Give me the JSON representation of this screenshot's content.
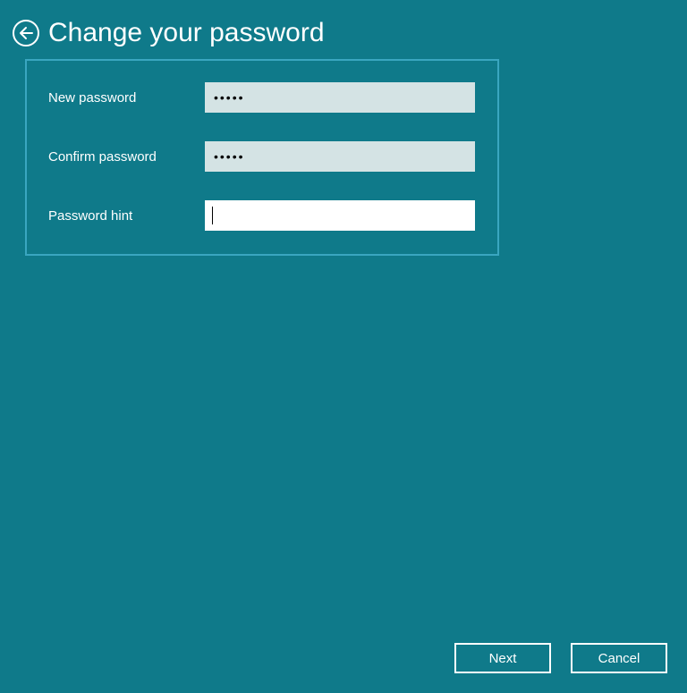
{
  "header": {
    "title": "Change your password"
  },
  "form": {
    "new_password": {
      "label": "New password",
      "masked_value": "•••••"
    },
    "confirm_password": {
      "label": "Confirm password",
      "masked_value": "•••••"
    },
    "password_hint": {
      "label": "Password hint",
      "value": ""
    }
  },
  "buttons": {
    "next": "Next",
    "cancel": "Cancel"
  },
  "colors": {
    "background": "#0f7a8a",
    "panel_border": "#3aa6c0",
    "input_filled": "#d4e3e4",
    "input_empty": "#ffffff"
  }
}
